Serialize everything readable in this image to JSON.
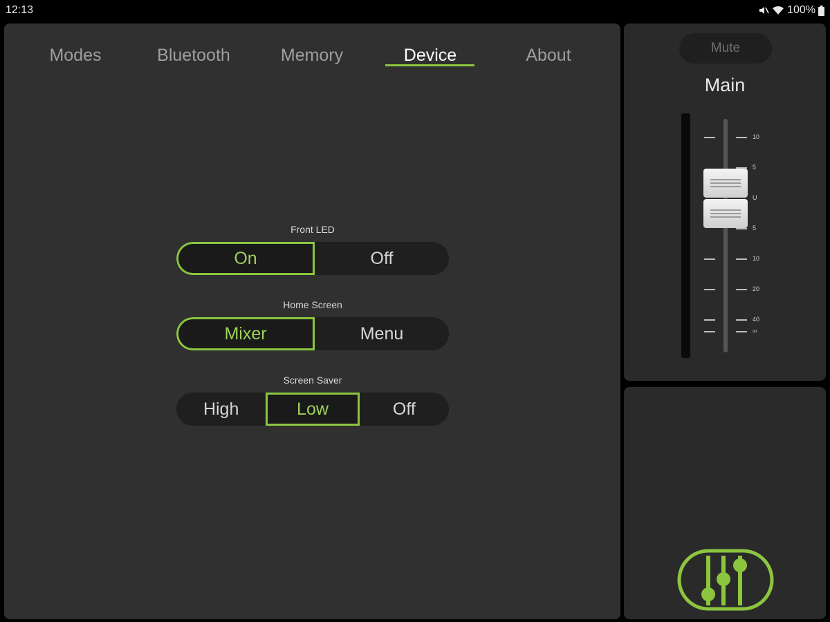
{
  "status": {
    "time": "12:13",
    "battery": "100%"
  },
  "tabs": [
    {
      "label": "Modes"
    },
    {
      "label": "Bluetooth"
    },
    {
      "label": "Memory"
    },
    {
      "label": "Device"
    },
    {
      "label": "About"
    }
  ],
  "active_tab": "Device",
  "device": {
    "front_led": {
      "label": "Front LED",
      "options": [
        "On",
        "Off"
      ],
      "selected": "On"
    },
    "home_screen": {
      "label": "Home Screen",
      "options": [
        "Mixer",
        "Menu"
      ],
      "selected": "Mixer"
    },
    "screen_saver": {
      "label": "Screen Saver",
      "options": [
        "High",
        "Low",
        "Off"
      ],
      "selected": "Low"
    }
  },
  "channel": {
    "mute_label": "Mute",
    "name": "Main",
    "scale": [
      "10",
      "5",
      "U",
      "5",
      "10",
      "20",
      "40",
      "∞"
    ]
  },
  "icons": {
    "status": [
      "mute-icon",
      "wifi-icon",
      "battery-icon"
    ],
    "logo": "mixer-logo-icon"
  },
  "colors": {
    "accent": "#8cc63f",
    "panel": "#303030",
    "background": "#000000"
  }
}
